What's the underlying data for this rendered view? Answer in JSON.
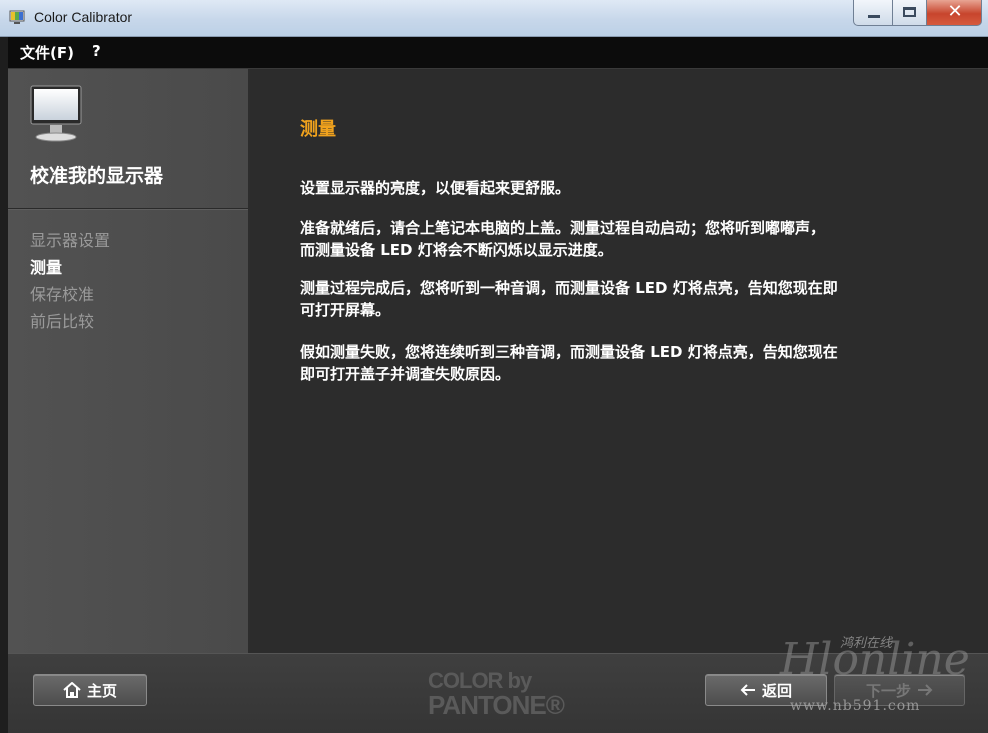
{
  "window": {
    "title": "Color Calibrator",
    "close_glyph": "✕"
  },
  "menu": {
    "file": "文件(F)",
    "help": "?"
  },
  "sidebar": {
    "title": "校准我的显示器",
    "steps": [
      {
        "label": "显示器设置"
      },
      {
        "label": "测量"
      },
      {
        "label": "保存校准"
      },
      {
        "label": "前后比较"
      }
    ],
    "active_step": 1
  },
  "content": {
    "title": "测量",
    "paragraphs": [
      "设置显示器的亮度，以便看起来更舒服。",
      "准备就绪后，请合上笔记本电脑的上盖。测量过程自动启动；您将听到嘟嘟声，\n而测量设备 LED 灯将会不断闪烁以显示进度。",
      "测量过程完成后，您将听到一种音调，而测量设备 LED 灯将点亮，告知您现在即\n可打开屏幕。",
      "假如测量失败，您将连续听到三种音调，而测量设备 LED 灯将点亮，告知您现在\n即可打开盖子并调查失败原因。"
    ]
  },
  "footer": {
    "home_label": "主页",
    "back_label": "返回",
    "next_label": "下一步",
    "logo_line1": "COLOR by",
    "logo_line2": "PANTONE®"
  },
  "watermark": {
    "cn": "鸿利在线",
    "script": "Hlonline",
    "url": "www.nb591.com"
  },
  "colors": {
    "accent": "#f0a21d",
    "panel": "#2c2c2c",
    "sidebar": "#4e4e4e"
  }
}
